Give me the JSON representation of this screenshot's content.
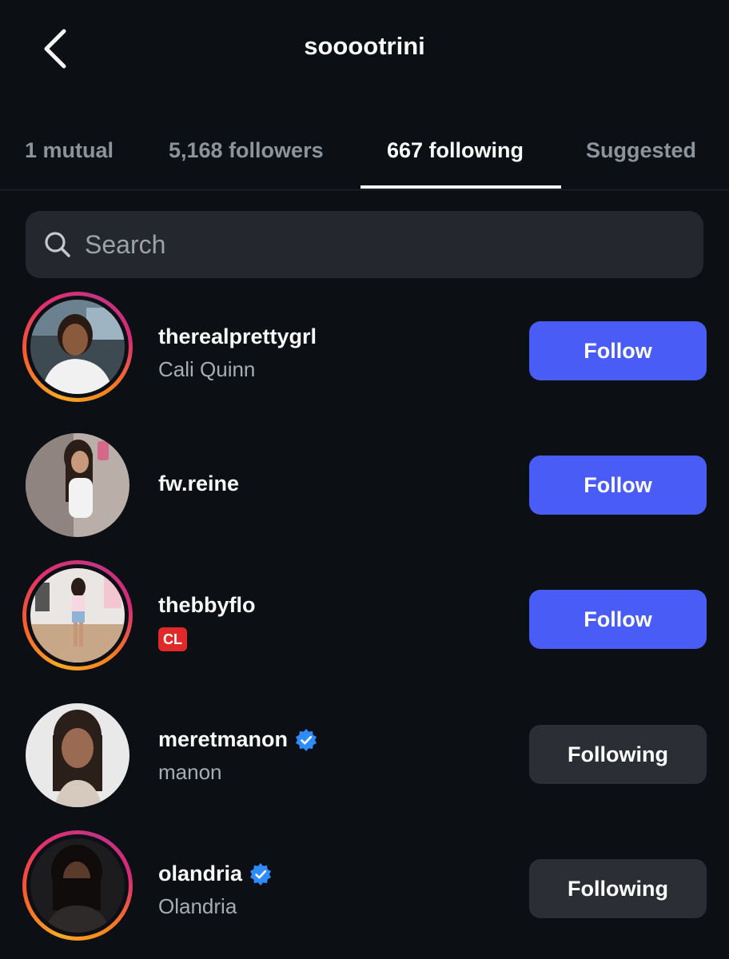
{
  "header": {
    "title": "sooootrini",
    "back_icon": "chevron-left-icon"
  },
  "tabs": [
    {
      "label": "1 mutual",
      "active": false
    },
    {
      "label": "5,168 followers",
      "active": false
    },
    {
      "label": "667 following",
      "active": true
    },
    {
      "label": "Suggested",
      "active": false
    }
  ],
  "search": {
    "placeholder": "Search",
    "value": ""
  },
  "accounts": [
    {
      "username": "therealprettygrl",
      "full_name": "Cali Quinn",
      "verified": false,
      "story_ring": true,
      "badge": "",
      "button_label": "Follow",
      "button_state": "follow"
    },
    {
      "username": "fw.reine",
      "full_name": "",
      "verified": false,
      "story_ring": false,
      "badge": "",
      "button_label": "Follow",
      "button_state": "follow"
    },
    {
      "username": "thebbyflo",
      "full_name": "",
      "verified": false,
      "story_ring": true,
      "badge": "CL",
      "button_label": "Follow",
      "button_state": "follow"
    },
    {
      "username": "meretmanon",
      "full_name": "manon",
      "verified": true,
      "story_ring": false,
      "badge": "",
      "button_label": "Following",
      "button_state": "following"
    },
    {
      "username": "olandria",
      "full_name": "Olandria",
      "verified": true,
      "story_ring": true,
      "badge": "",
      "button_label": "Following",
      "button_state": "following"
    }
  ],
  "colors": {
    "background": "#0c0f14",
    "follow_button": "#4a5cf6",
    "following_button": "#2b2e34",
    "verified_badge": "#2f8cff",
    "cl_badge": "#e02a2a"
  }
}
